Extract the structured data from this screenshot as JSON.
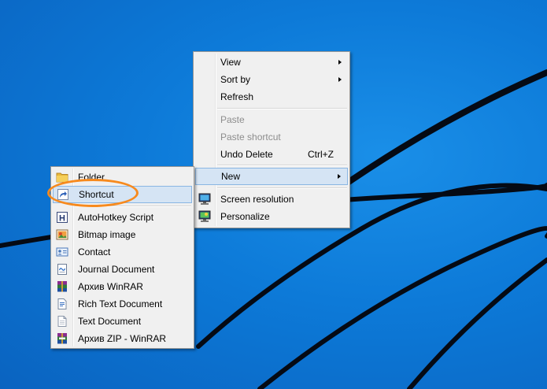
{
  "context_menu": {
    "items": [
      {
        "label": "View",
        "submenu": true
      },
      {
        "label": "Sort by",
        "submenu": true
      },
      {
        "label": "Refresh"
      },
      {
        "label": "Paste",
        "disabled": true
      },
      {
        "label": "Paste shortcut",
        "disabled": true
      },
      {
        "label": "Undo Delete",
        "shortcut": "Ctrl+Z"
      },
      {
        "label": "New",
        "submenu": true,
        "highlighted": true
      },
      {
        "label": "Screen resolution",
        "icon": "screen-resolution-icon"
      },
      {
        "label": "Personalize",
        "icon": "personalize-icon"
      }
    ]
  },
  "new_submenu": {
    "items": [
      {
        "label": "Folder",
        "icon": "folder-icon"
      },
      {
        "label": "Shortcut",
        "icon": "shortcut-icon",
        "highlighted": true
      },
      {
        "label": "AutoHotkey Script",
        "icon": "autohotkey-icon"
      },
      {
        "label": "Bitmap image",
        "icon": "bitmap-icon"
      },
      {
        "label": "Contact",
        "icon": "contact-icon"
      },
      {
        "label": "Journal Document",
        "icon": "journal-icon"
      },
      {
        "label": "Архив WinRAR",
        "icon": "winrar-icon"
      },
      {
        "label": "Rich Text Document",
        "icon": "rich-text-icon"
      },
      {
        "label": "Text Document",
        "icon": "text-document-icon"
      },
      {
        "label": "Архив ZIP - WinRAR",
        "icon": "winrar-zip-icon"
      }
    ]
  },
  "colors": {
    "desktop_blue": "#0d7ad8",
    "highlight_fill": "#d5e4f4",
    "highlight_border": "#8ab6e3",
    "annotation_orange": "#f78a1e"
  }
}
